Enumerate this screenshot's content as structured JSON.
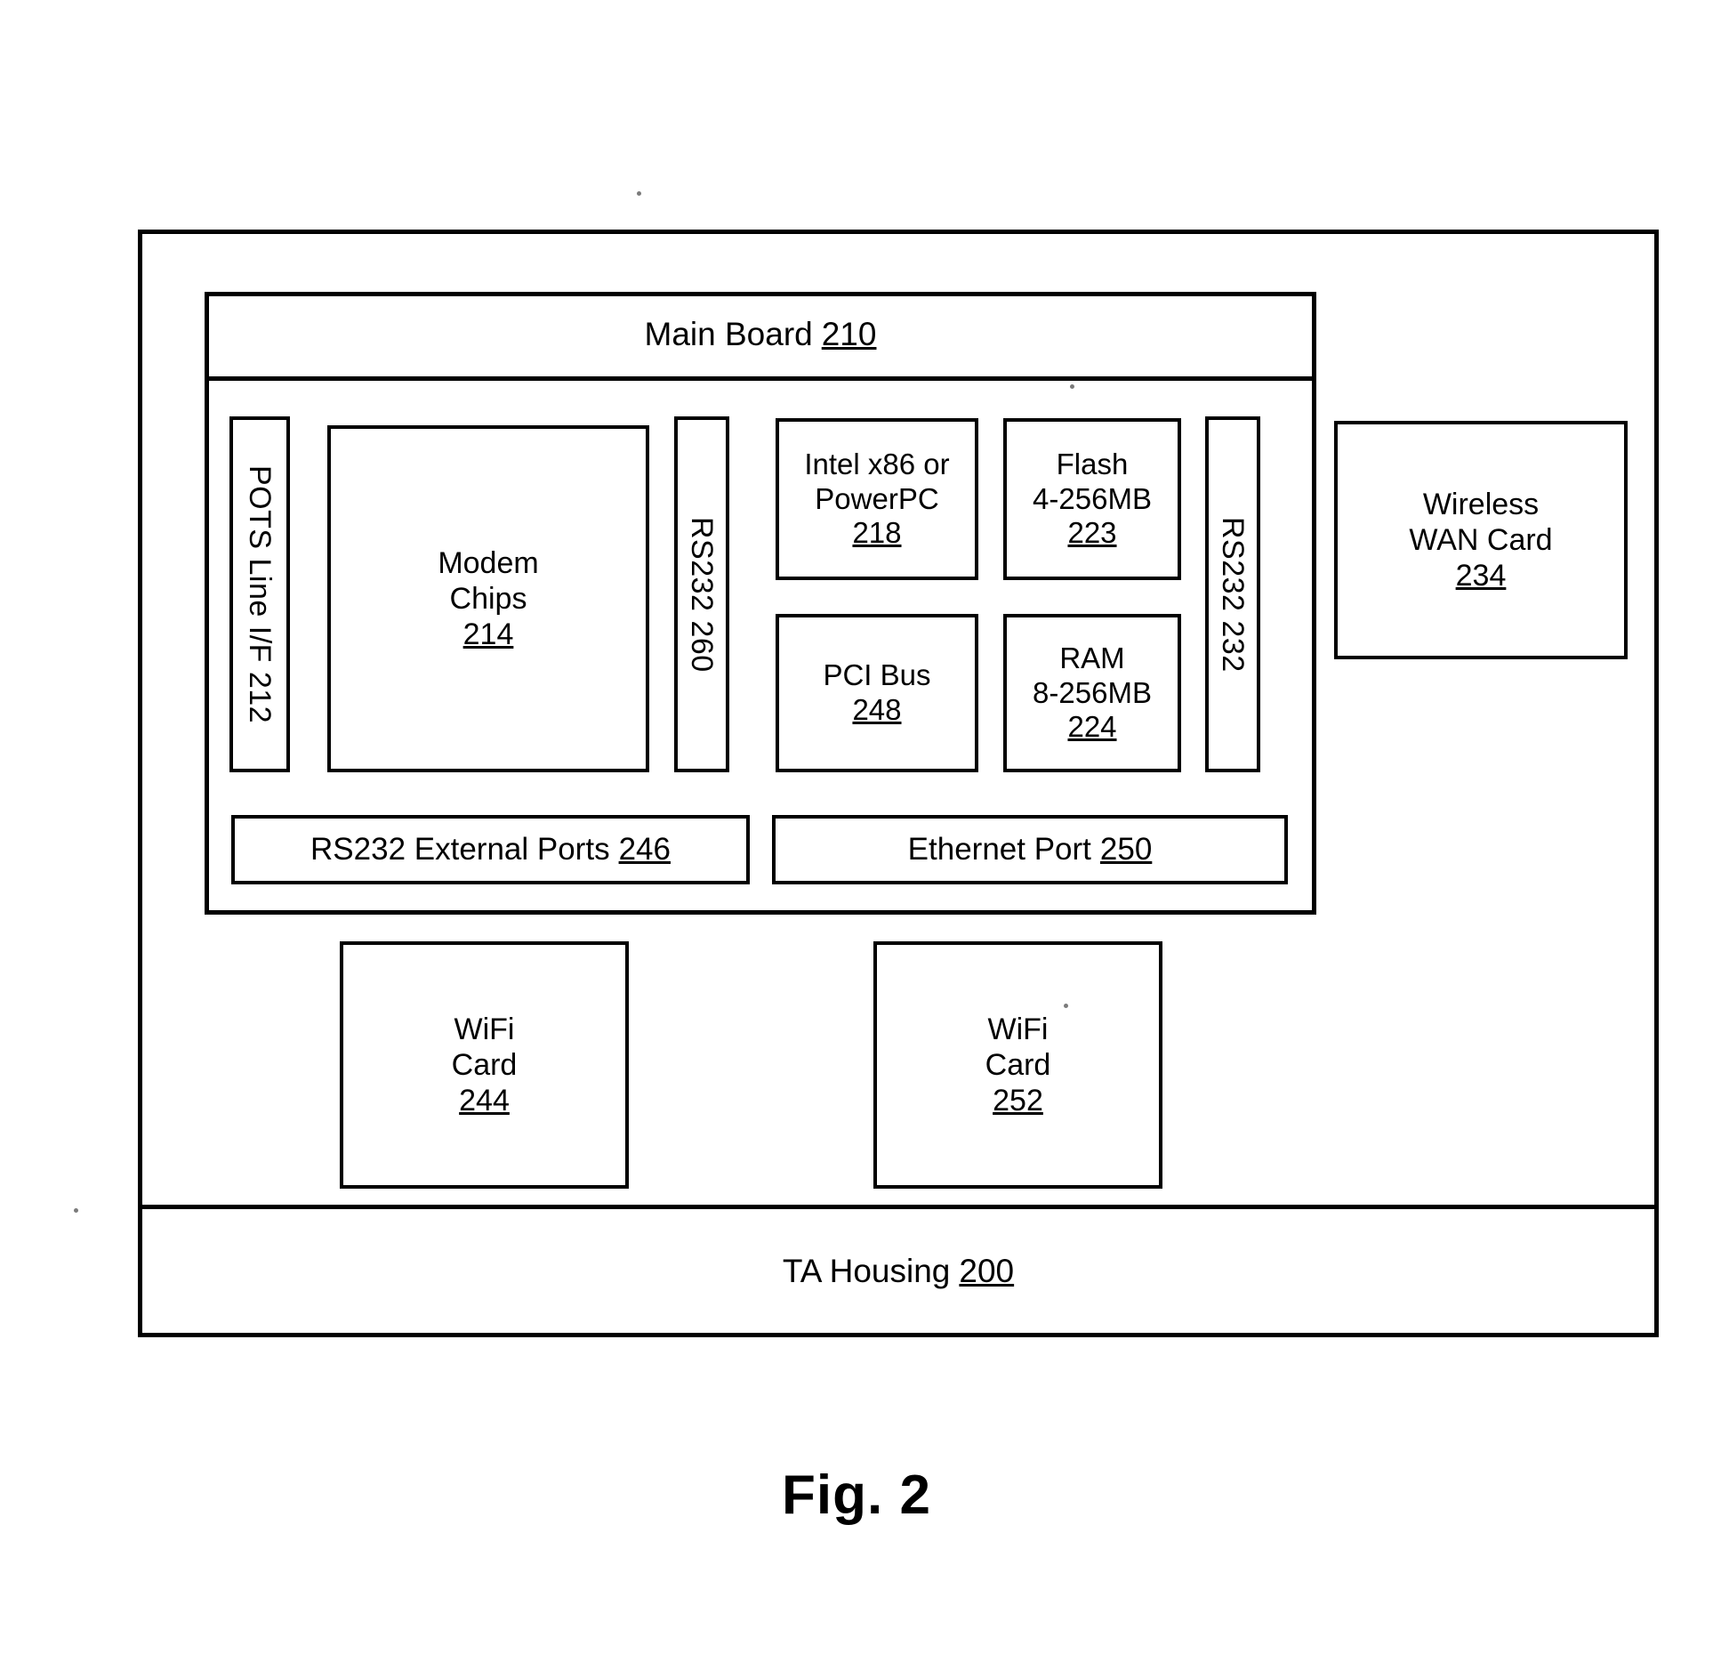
{
  "figure": {
    "caption": "Fig. 2"
  },
  "housing": {
    "label": "TA Housing",
    "ref": "200"
  },
  "main_board": {
    "label": "Main Board",
    "ref": "210"
  },
  "vertical_blocks": [
    {
      "name": "pots-line-interface",
      "text": "POTS Line I/F 212",
      "label": "POTS Line I/F",
      "ref": "212"
    },
    {
      "name": "rs232-260",
      "text": "RS232 260",
      "label": "RS232",
      "ref": "260"
    },
    {
      "name": "rs232-232",
      "text": "RS232 232",
      "label": "RS232",
      "ref": "232"
    }
  ],
  "blocks": {
    "modem_chips": {
      "line1": "Modem",
      "line2": "Chips",
      "ref": "214"
    },
    "cpu": {
      "line1": "Intel x86 or",
      "line2": "PowerPC",
      "ref": "218"
    },
    "flash": {
      "line1": "Flash",
      "line2": "4-256MB",
      "ref": "223"
    },
    "pci_bus": {
      "line1": "PCI Bus",
      "ref": "248"
    },
    "ram": {
      "line1": "RAM",
      "line2": "8-256MB",
      "ref": "224"
    },
    "rs232_external_ports": {
      "label": "RS232 External Ports",
      "ref": "246"
    },
    "ethernet_port": {
      "label": "Ethernet Port",
      "ref": "250"
    },
    "wireless_wan_card": {
      "line1": "Wireless",
      "line2": "WAN Card",
      "ref": "234"
    },
    "wifi_card_244": {
      "line1": "WiFi",
      "line2": "Card",
      "ref": "244"
    },
    "wifi_card_252": {
      "line1": "WiFi",
      "line2": "Card",
      "ref": "252"
    }
  },
  "colors": {
    "ink": "#000000",
    "paper": "#ffffff"
  }
}
